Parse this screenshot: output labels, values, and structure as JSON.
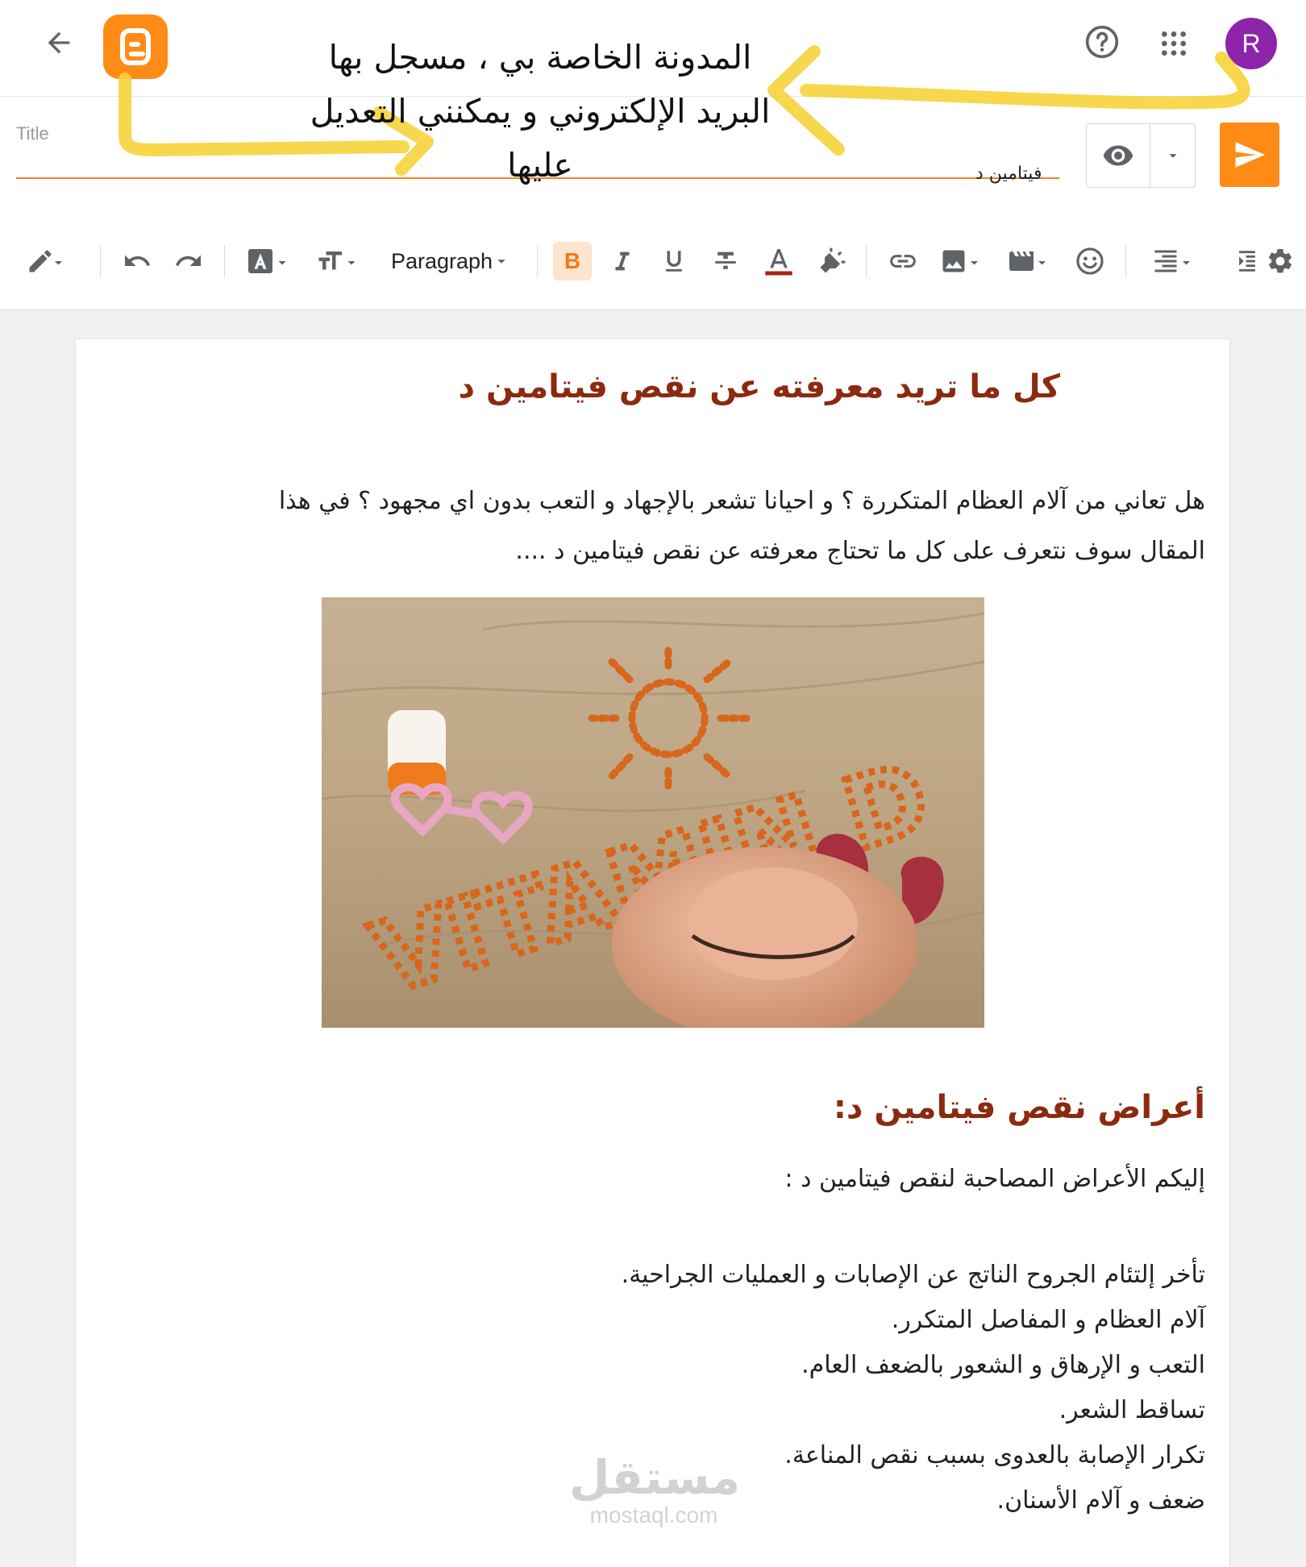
{
  "header": {
    "avatar_letter": "R",
    "annotation_lines": [
      "المدونة الخاصة بي ، مسجل بها",
      "البريد الإلكتروني و يمكنني التعديل",
      "عليها"
    ],
    "colors": {
      "brand": "#ff8b17",
      "avatar": "#8e24aa",
      "annotation": "#f7d33a"
    }
  },
  "titlebar": {
    "title_placeholder": "Title",
    "label": "فيتامين د"
  },
  "toolbar": {
    "paragraph_label": "Paragraph",
    "bold_label": "B",
    "icons": [
      "pencil-icon",
      "undo-icon",
      "redo-icon",
      "font-color-box-icon",
      "text-size-icon",
      "bold-icon",
      "italic-icon",
      "underline-icon",
      "strikethrough-icon",
      "text-color-icon",
      "highlight-icon",
      "link-icon",
      "image-icon",
      "video-icon",
      "emoji-icon",
      "align-icon",
      "indent-icon",
      "settings-icon"
    ]
  },
  "content": {
    "heading": "كل ما تريد معرفته عن نقص فيتامين د",
    "intro_lines": [
      "هل تعاني من آلام العظام المتكررة ؟ و احيانا تشعر بالإجهاد و التعب بدون اي مجهود ؟ في هذا",
      "المقال سوف نتعرف على كل ما تحتاج معرفته عن نقص فيتامين د ...."
    ],
    "image_text": "VITAMIN D",
    "symptoms_heading": "أعراض نقص فيتامين د:",
    "symptoms_intro": "إليكم الأعراض المصاحبة لنقص فيتامين د :",
    "symptoms": [
      "تأخر إلتئام الجروح الناتج عن الإصابات و العمليات الجراحية.",
      "آلام العظام و المفاصل المتكرر.",
      "التعب و الإرهاق و الشعور بالضعف العام.",
      "تساقط الشعر.",
      "تكرار الإصابة بالعدوى بسبب نقص المناعة.",
      "ضعف و آلام الأسنان."
    ]
  },
  "watermark": {
    "arabic": "مستقل",
    "latin": "mostaql.com"
  }
}
